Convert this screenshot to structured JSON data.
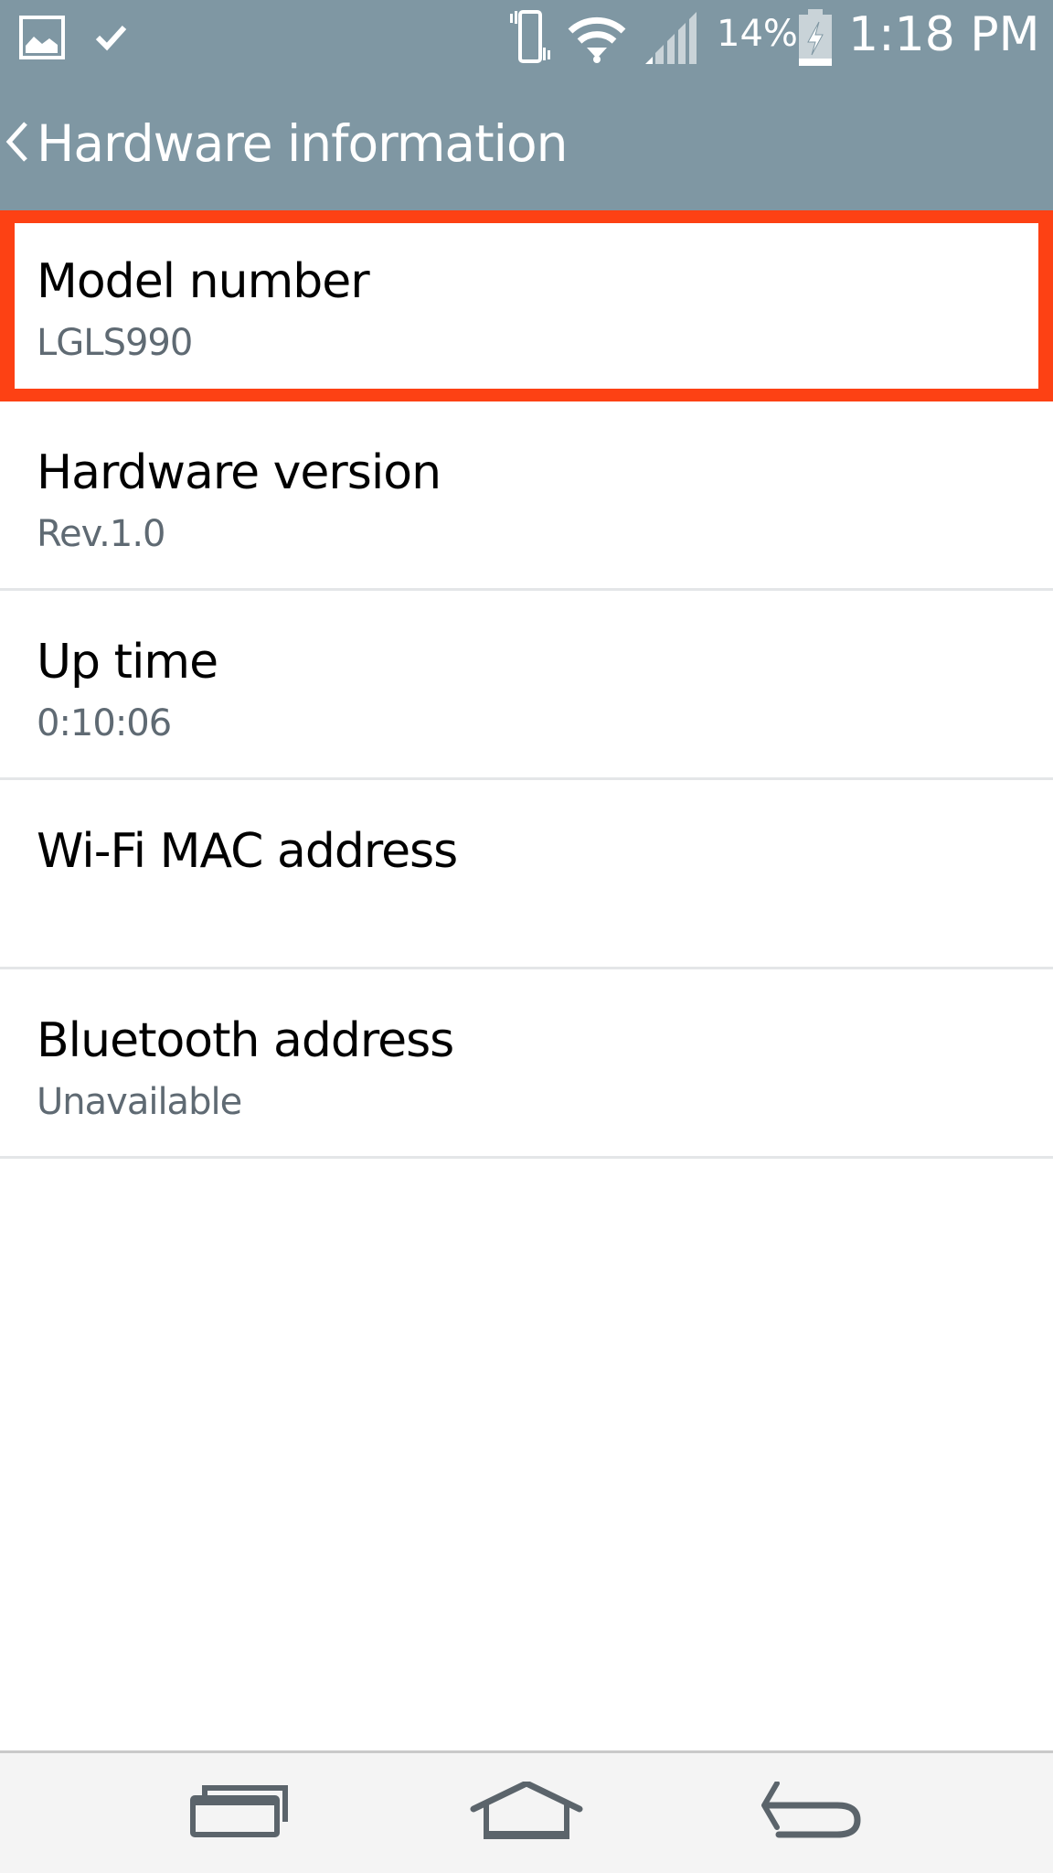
{
  "status_bar": {
    "notification_icons": [
      "gallery-icon",
      "check-icon"
    ],
    "system_icons": [
      "vibrate-icon",
      "wifi-icon",
      "signal-icon",
      "battery-charging-icon"
    ],
    "battery_percent": "14%",
    "battery_level": 0.14,
    "time": "1:18 PM"
  },
  "header": {
    "back_icon": "chevron-left-icon",
    "title": "Hardware information"
  },
  "items": [
    {
      "label": "Model number",
      "value": "LGLS990",
      "highlighted": true
    },
    {
      "label": "Hardware version",
      "value": "Rev.1.0"
    },
    {
      "label": "Up time",
      "value": "0:10:06"
    },
    {
      "label": "Wi-Fi MAC address",
      "value": ""
    },
    {
      "label": "Bluetooth address",
      "value": "Unavailable"
    }
  ],
  "nav_bar": {
    "buttons": [
      {
        "name": "recent-apps",
        "icon": "recent-apps-icon"
      },
      {
        "name": "home",
        "icon": "home-icon"
      },
      {
        "name": "back",
        "icon": "back-arrow-icon"
      }
    ]
  },
  "colors": {
    "header_bg": "#7f97a3",
    "highlight": "#fd4114",
    "secondary_text": "#5f6a73",
    "nav_icon": "#5b646b",
    "nav_bg": "#f4f4f4"
  }
}
